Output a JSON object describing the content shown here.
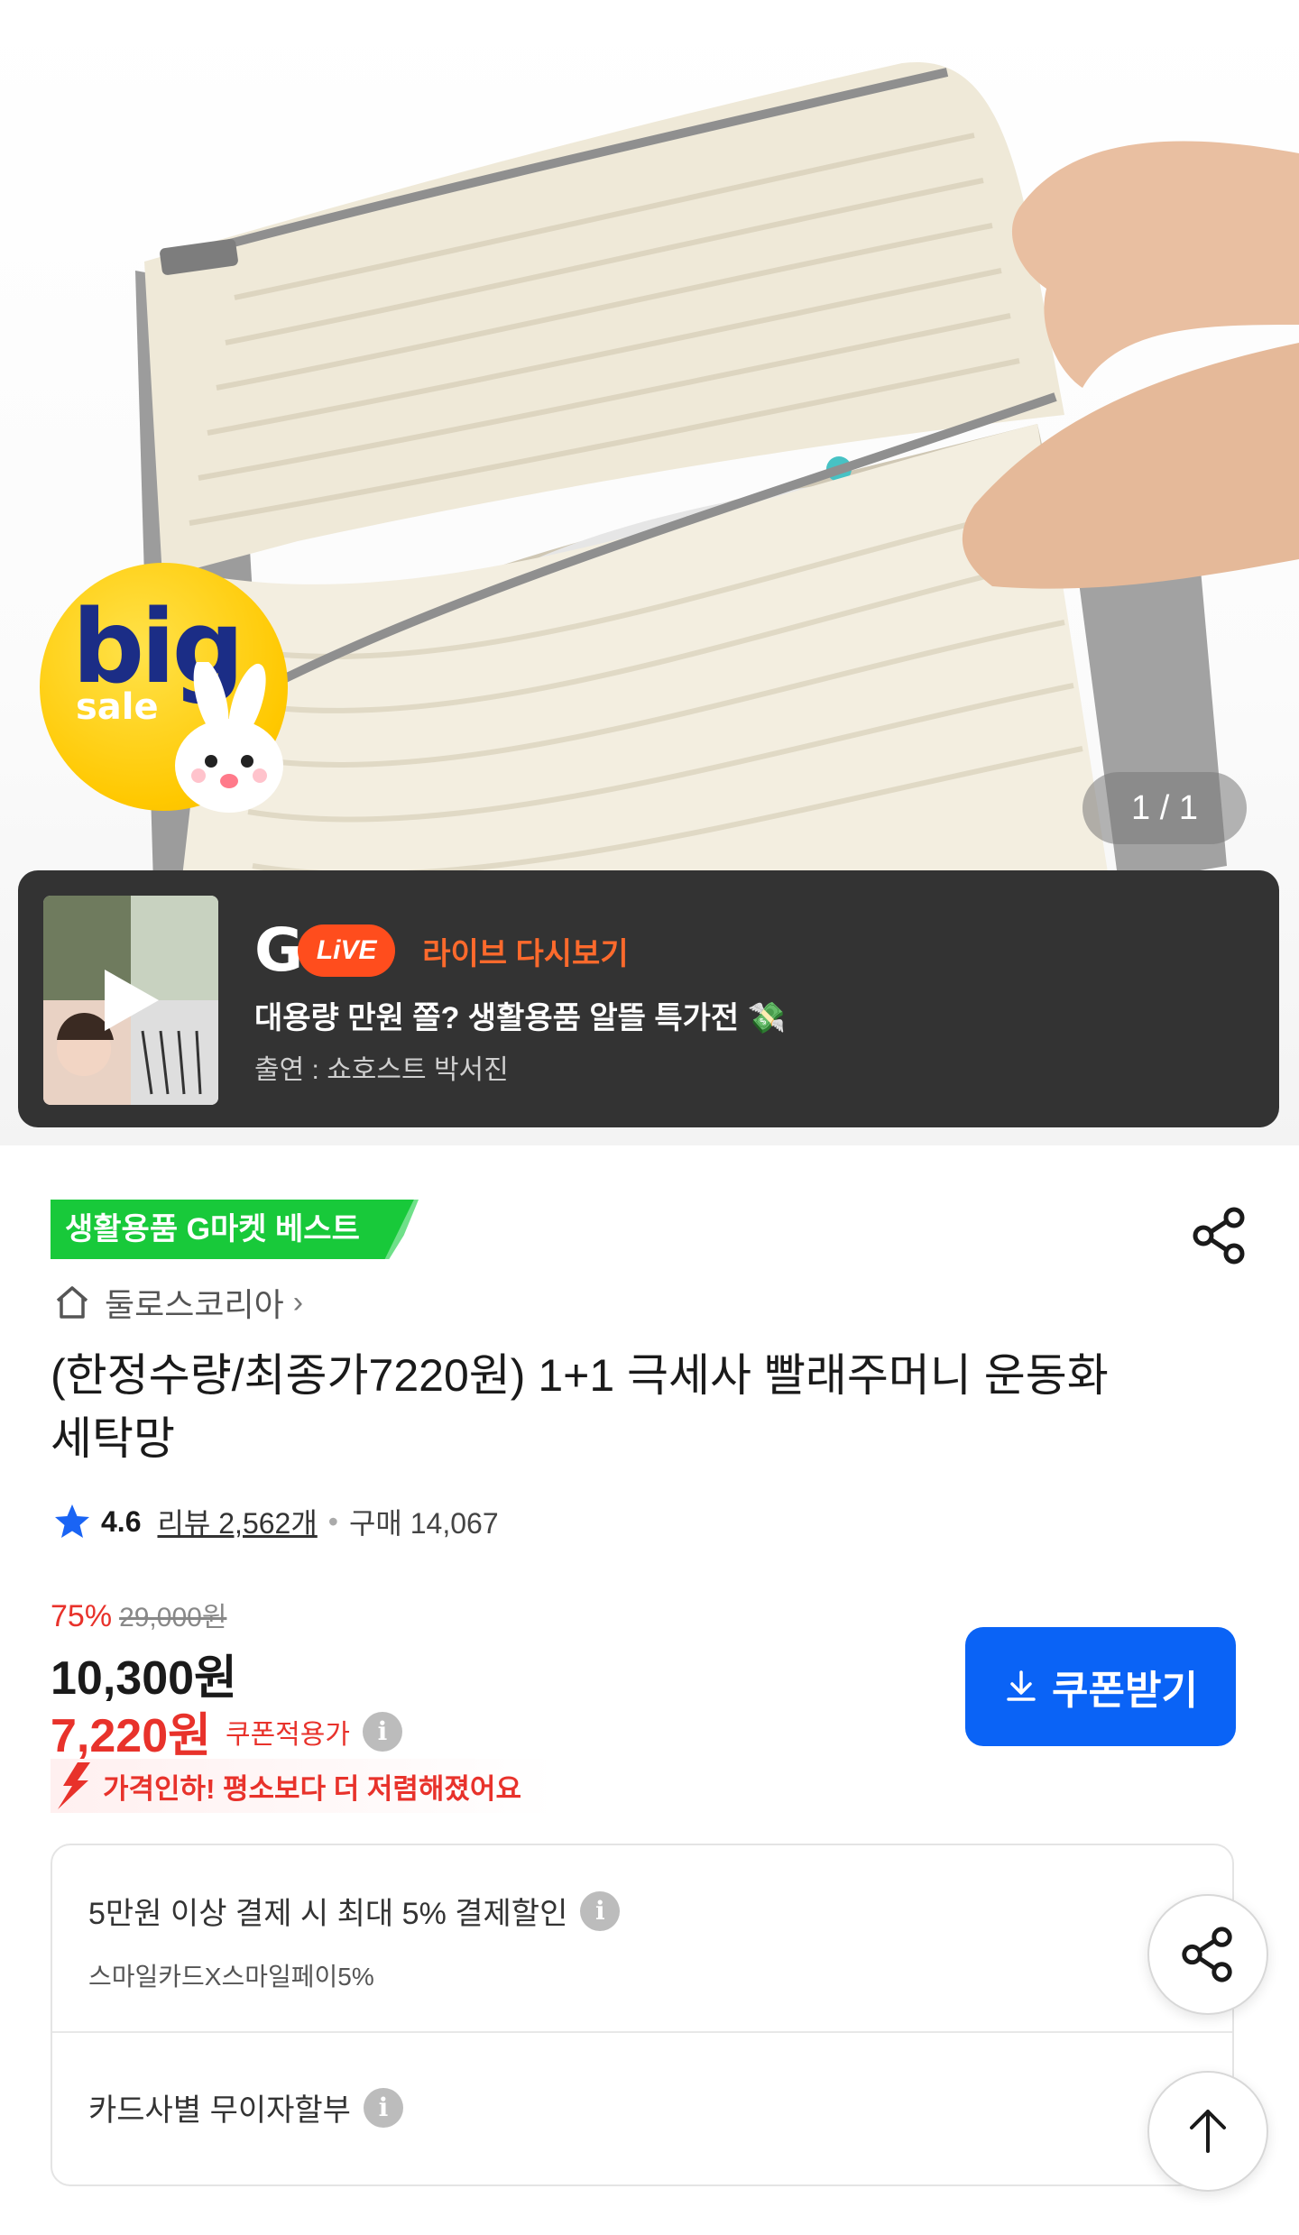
{
  "hero": {
    "badge_big": "big",
    "badge_sale": "sale",
    "page_indicator": "1 / 1"
  },
  "live": {
    "logo_g": "G",
    "logo_live": "LiVE",
    "replay_label": "라이브 다시보기",
    "title": "대용량 만원 쫄? 생활용품 알뜰 특가전 💸",
    "cast": "출연 : 쇼호스트 박서진"
  },
  "product": {
    "best_badge": "생활용품 G마켓 베스트",
    "seller": "둘로스코리아",
    "title": "(한정수량/최종가7220원) 1+1 극세사 빨래주머니 운동화 세탁망",
    "rating": "4.6",
    "reviews": "리뷰 2,562개",
    "purchases": "구매 14,067"
  },
  "price": {
    "discount_rate": "75%",
    "original_price": "29,000원",
    "sale_price": "10,300원",
    "coupon_price": "7,220원",
    "coupon_label": "쿠폰적용가",
    "price_drop_text": "가격인하! 평소보다 더 저렴해졌어요",
    "coupon_button": "쿠폰받기"
  },
  "benefits": {
    "payment_discount": "5만원 이상 결제 시 최대  5% 결제할인",
    "payment_card": "스마일카드X스마일페이5%",
    "installment": "카드사별 무이자할부"
  },
  "colors": {
    "accent_blue": "#0a63f6",
    "price_red": "#e8322b",
    "best_green": "#18c93a",
    "live_orange": "#ff4d1d"
  },
  "icons": {
    "share": "share-icon",
    "home": "home-icon",
    "star": "star-icon",
    "info": "info-icon",
    "download": "download-icon",
    "scroll_top": "arrow-up-icon"
  }
}
